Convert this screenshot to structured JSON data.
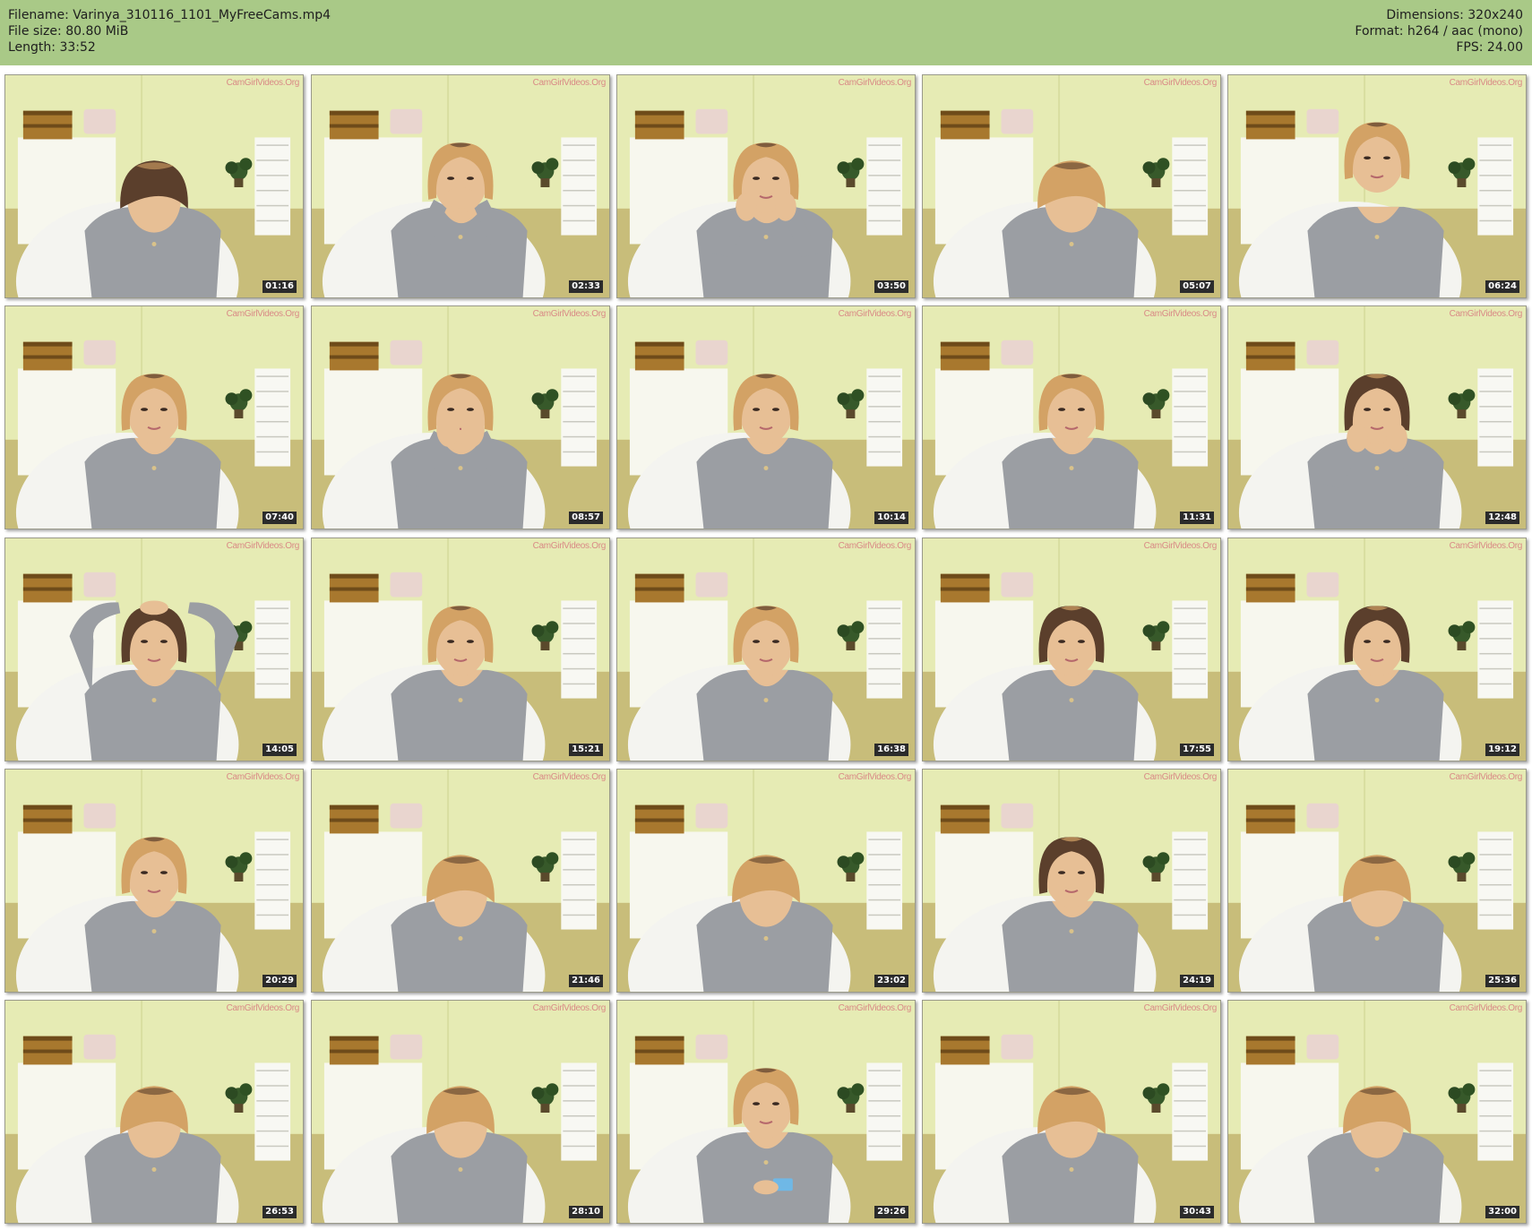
{
  "header": {
    "filename": "Filename: Varinya_310116_1101_MyFreeCams.mp4",
    "filesize": "File size: 80.80 MiB",
    "length": "Length: 33:52",
    "dimensions": "Dimensions: 320x240",
    "format": "Format: h264 / aac (mono)",
    "fps": "FPS: 24.00"
  },
  "watermark": "CamGirlVideos.Org",
  "colors": {
    "header_bg": "#a9c987",
    "wall": "#e6ebb4",
    "floor": "#c8bd7a",
    "shirt": "#9b9ea3",
    "chair": "#f4f4f0",
    "hair_dark": "#5b3f2c",
    "hair_light": "#d3a265",
    "skin": "#e7bf95"
  },
  "thumbnails": [
    {
      "time": "01:16",
      "pose": "down",
      "hair": "dark"
    },
    {
      "time": "02:33",
      "pose": "hand-mouth",
      "hair": "light"
    },
    {
      "time": "03:50",
      "pose": "hands-chin",
      "hair": "light"
    },
    {
      "time": "05:07",
      "pose": "down",
      "hair": "light"
    },
    {
      "time": "06:24",
      "pose": "up",
      "hair": "light"
    },
    {
      "time": "07:40",
      "pose": "front",
      "hair": "light"
    },
    {
      "time": "08:57",
      "pose": "hands-face",
      "hair": "light"
    },
    {
      "time": "10:14",
      "pose": "front",
      "hair": "light"
    },
    {
      "time": "11:31",
      "pose": "front",
      "hair": "light"
    },
    {
      "time": "12:48",
      "pose": "hands-chin",
      "hair": "dark"
    },
    {
      "time": "14:05",
      "pose": "arms-up",
      "hair": "dark"
    },
    {
      "time": "15:21",
      "pose": "front",
      "hair": "light"
    },
    {
      "time": "16:38",
      "pose": "front",
      "hair": "light"
    },
    {
      "time": "17:55",
      "pose": "front",
      "hair": "dark"
    },
    {
      "time": "19:12",
      "pose": "front",
      "hair": "dark"
    },
    {
      "time": "20:29",
      "pose": "front",
      "hair": "light"
    },
    {
      "time": "21:46",
      "pose": "down",
      "hair": "light"
    },
    {
      "time": "23:02",
      "pose": "down",
      "hair": "light"
    },
    {
      "time": "24:19",
      "pose": "front",
      "hair": "dark"
    },
    {
      "time": "25:36",
      "pose": "down",
      "hair": "light"
    },
    {
      "time": "26:53",
      "pose": "down",
      "hair": "light"
    },
    {
      "time": "28:10",
      "pose": "down",
      "hair": "light"
    },
    {
      "time": "29:26",
      "pose": "phone",
      "hair": "light"
    },
    {
      "time": "30:43",
      "pose": "down",
      "hair": "light"
    },
    {
      "time": "32:00",
      "pose": "down",
      "hair": "light"
    }
  ]
}
